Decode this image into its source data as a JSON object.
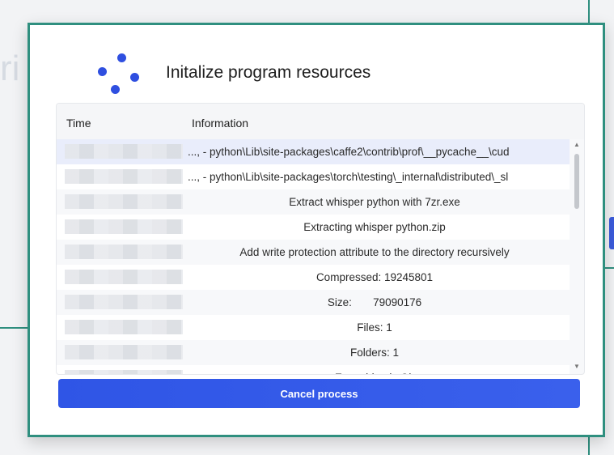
{
  "background": {
    "partial_letter": "ri"
  },
  "dialog": {
    "title": "Initalize program resources",
    "columns": {
      "time": "Time",
      "information": "Information"
    },
    "rows": [
      {
        "info": "..., - python\\Lib\\site-packages\\caffe2\\contrib\\prof\\__pycache__\\cud",
        "align": "left",
        "selected": true
      },
      {
        "info": "..., - python\\Lib\\site-packages\\torch\\testing\\_internal\\distributed\\_sl",
        "align": "left"
      },
      {
        "info": "Extract whisper python with 7zr.exe",
        "align": "center"
      },
      {
        "info": "Extracting whisper python.zip",
        "align": "center"
      },
      {
        "info": "Add write protection attribute to the directory recursively",
        "align": "center"
      },
      {
        "info": "Compressed: 19245801",
        "align": "center"
      },
      {
        "info": "Size:       79090176",
        "align": "center"
      },
      {
        "info": "Files: 1",
        "align": "center"
      },
      {
        "info": "Folders: 1",
        "align": "center"
      },
      {
        "info": "Everything is Ok",
        "align": "center"
      }
    ],
    "cancel_label": "Cancel process"
  },
  "colors": {
    "accent": "#2f55e6",
    "frame": "#2f8f7f"
  }
}
